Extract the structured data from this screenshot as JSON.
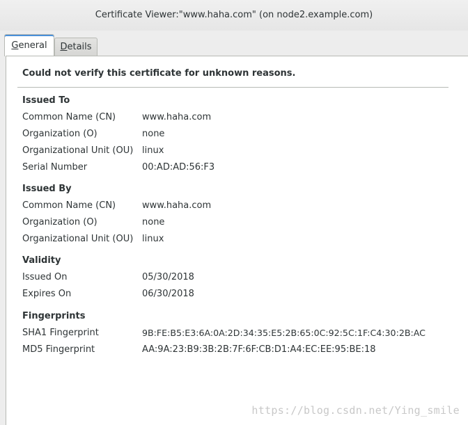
{
  "window": {
    "title": "Certificate Viewer:\"www.haha.com\" (on node2.example.com)"
  },
  "tabs": [
    {
      "label_underlined": "G",
      "label_rest": "eneral"
    },
    {
      "label_underlined": "D",
      "label_rest": "etails"
    }
  ],
  "general": {
    "warning": "Could not verify this certificate for unknown reasons.",
    "issued_to": {
      "title": "Issued To",
      "rows": [
        {
          "label": "Common Name (CN)",
          "value": "www.haha.com"
        },
        {
          "label": "Organization (O)",
          "value": "none"
        },
        {
          "label": "Organizational Unit (OU)",
          "value": "linux"
        },
        {
          "label": "Serial Number",
          "value": "00:AD:AD:56:F3"
        }
      ]
    },
    "issued_by": {
      "title": "Issued By",
      "rows": [
        {
          "label": "Common Name (CN)",
          "value": "www.haha.com"
        },
        {
          "label": "Organization (O)",
          "value": "none"
        },
        {
          "label": "Organizational Unit (OU)",
          "value": "linux"
        }
      ]
    },
    "validity": {
      "title": "Validity",
      "rows": [
        {
          "label": "Issued On",
          "value": "05/30/2018"
        },
        {
          "label": "Expires On",
          "value": "06/30/2018"
        }
      ]
    },
    "fingerprints": {
      "title": "Fingerprints",
      "rows": [
        {
          "label": "SHA1 Fingerprint",
          "value": "9B:FE:B5:E3:6A:0A:2D:34:35:E5:2B:65:0C:92:5C:1F:C4:30:2B:AC"
        },
        {
          "label": "MD5 Fingerprint",
          "value": "AA:9A:23:B9:3B:2B:7F:6F:CB:D1:A4:EC:EE:95:BE:18"
        }
      ]
    }
  },
  "watermark": "https://blog.csdn.net/Ying_smile"
}
